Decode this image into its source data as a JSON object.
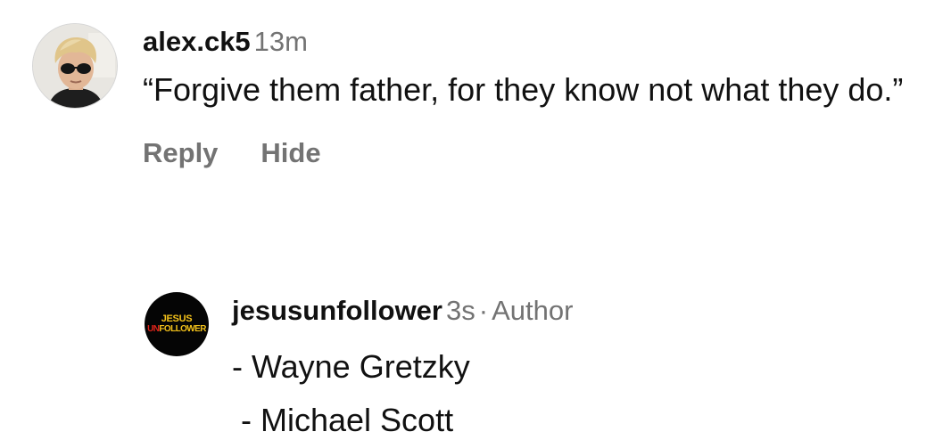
{
  "comment": {
    "username": "alex.ck5",
    "timestamp": "13m",
    "text": "“Forgive them father, for they know not what they do.”",
    "actions": {
      "reply": "Reply",
      "hide": "Hide"
    },
    "avatar": "profile-photo"
  },
  "reply": {
    "username": "jesusunfollower",
    "timestamp": "3s",
    "separator": "·",
    "author_badge": "Author",
    "lines": [
      "- Wayne Gretzky",
      " - Michael Scott"
    ],
    "avatar": {
      "logo_top": "JESUS",
      "logo_bottom_accent": "UN",
      "logo_bottom_rest": "FOLLOWER",
      "accent_color": "#e2241b",
      "brand_color": "#f4c21a"
    }
  }
}
